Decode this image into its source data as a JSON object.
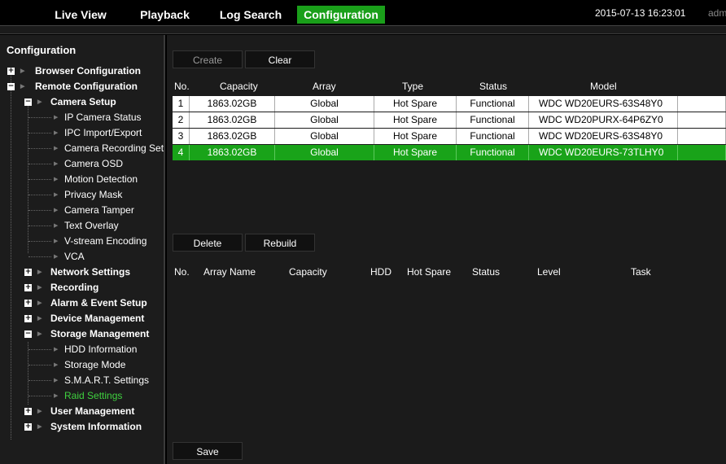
{
  "topbar": {
    "tabs": [
      {
        "label": "Live View",
        "active": false
      },
      {
        "label": "Playback",
        "active": false
      },
      {
        "label": "Log Search",
        "active": false
      },
      {
        "label": "Configuration",
        "active": true
      }
    ],
    "datetime": "2015-07-13 16:23:01",
    "user": "adm"
  },
  "sidebar": {
    "title": "Configuration",
    "items": [
      {
        "label": "Browser Configuration",
        "icon": "plus"
      },
      {
        "label": "Remote Configuration",
        "icon": "minus"
      },
      {
        "label": "Camera Setup",
        "icon": "minus"
      },
      {
        "label": "IP Camera Status"
      },
      {
        "label": "IPC Import/Export"
      },
      {
        "label": "Camera Recording Set"
      },
      {
        "label": "Camera OSD"
      },
      {
        "label": "Motion Detection"
      },
      {
        "label": "Privacy Mask"
      },
      {
        "label": "Camera Tamper"
      },
      {
        "label": "Text Overlay"
      },
      {
        "label": "V-stream Encoding"
      },
      {
        "label": "VCA"
      },
      {
        "label": "Network Settings",
        "icon": "plus"
      },
      {
        "label": "Recording",
        "icon": "plus"
      },
      {
        "label": "Alarm & Event Setup",
        "icon": "plus"
      },
      {
        "label": "Device Management",
        "icon": "plus"
      },
      {
        "label": "Storage Management",
        "icon": "minus"
      },
      {
        "label": "HDD Information"
      },
      {
        "label": "Storage Mode"
      },
      {
        "label": "S.M.A.R.T. Settings"
      },
      {
        "label": "Raid Settings",
        "active": true
      },
      {
        "label": "User Management",
        "icon": "plus"
      },
      {
        "label": "System Information",
        "icon": "plus"
      }
    ]
  },
  "toolbar1": {
    "create": "Create",
    "clear": "Clear"
  },
  "disk_table": {
    "headers": [
      "No.",
      "Capacity",
      "Array",
      "Type",
      "Status",
      "Model"
    ],
    "rows": [
      {
        "no": "1",
        "capacity": "1863.02GB",
        "array": "Global",
        "type": "Hot Spare",
        "status": "Functional",
        "model": "WDC WD20EURS-63S48Y0",
        "selected": false
      },
      {
        "no": "2",
        "capacity": "1863.02GB",
        "array": "Global",
        "type": "Hot Spare",
        "status": "Functional",
        "model": "WDC WD20PURX-64P6ZY0",
        "selected": false
      },
      {
        "no": "3",
        "capacity": "1863.02GB",
        "array": "Global",
        "type": "Hot Spare",
        "status": "Functional",
        "model": "WDC WD20EURS-63S48Y0",
        "selected": false
      },
      {
        "no": "4",
        "capacity": "1863.02GB",
        "array": "Global",
        "type": "Hot Spare",
        "status": "Functional",
        "model": "WDC WD20EURS-73TLHY0",
        "selected": true
      }
    ]
  },
  "toolbar2": {
    "delete": "Delete",
    "rebuild": "Rebuild"
  },
  "array_table": {
    "headers": [
      "No.",
      "Array Name",
      "Capacity",
      "HDD",
      "Hot Spare",
      "Status",
      "Level",
      "Task"
    ]
  },
  "save": "Save",
  "colors": {
    "accent": "#1a9f1a",
    "selected_row": "#19a319",
    "active_link": "#3fd13f"
  }
}
